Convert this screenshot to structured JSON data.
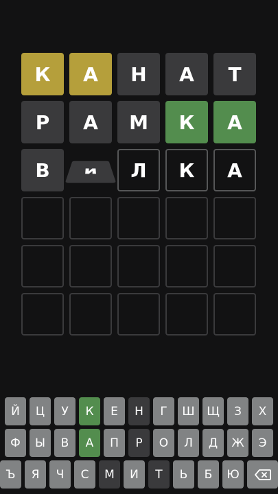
{
  "board": {
    "rows": [
      [
        {
          "letter": "К",
          "state": "present"
        },
        {
          "letter": "А",
          "state": "present"
        },
        {
          "letter": "Н",
          "state": "absent"
        },
        {
          "letter": "А",
          "state": "absent"
        },
        {
          "letter": "Т",
          "state": "absent"
        }
      ],
      [
        {
          "letter": "Р",
          "state": "absent"
        },
        {
          "letter": "А",
          "state": "absent"
        },
        {
          "letter": "М",
          "state": "absent"
        },
        {
          "letter": "К",
          "state": "correct"
        },
        {
          "letter": "А",
          "state": "correct"
        }
      ],
      [
        {
          "letter": "В",
          "state": "absent"
        },
        {
          "letter": "и",
          "state": "flipping"
        },
        {
          "letter": "Л",
          "state": "typed"
        },
        {
          "letter": "К",
          "state": "typed"
        },
        {
          "letter": "А",
          "state": "typed"
        }
      ],
      [
        {
          "letter": "",
          "state": "empty"
        },
        {
          "letter": "",
          "state": "empty"
        },
        {
          "letter": "",
          "state": "empty"
        },
        {
          "letter": "",
          "state": "empty"
        },
        {
          "letter": "",
          "state": "empty"
        }
      ],
      [
        {
          "letter": "",
          "state": "empty"
        },
        {
          "letter": "",
          "state": "empty"
        },
        {
          "letter": "",
          "state": "empty"
        },
        {
          "letter": "",
          "state": "empty"
        },
        {
          "letter": "",
          "state": "empty"
        }
      ],
      [
        {
          "letter": "",
          "state": "empty"
        },
        {
          "letter": "",
          "state": "empty"
        },
        {
          "letter": "",
          "state": "empty"
        },
        {
          "letter": "",
          "state": "empty"
        },
        {
          "letter": "",
          "state": "empty"
        }
      ]
    ]
  },
  "keyboard": {
    "rows": [
      [
        {
          "label": "Й",
          "state": "unused"
        },
        {
          "label": "Ц",
          "state": "unused"
        },
        {
          "label": "У",
          "state": "unused"
        },
        {
          "label": "К",
          "state": "correct"
        },
        {
          "label": "Е",
          "state": "unused"
        },
        {
          "label": "Н",
          "state": "absent"
        },
        {
          "label": "Г",
          "state": "unused"
        },
        {
          "label": "Ш",
          "state": "unused"
        },
        {
          "label": "Щ",
          "state": "unused"
        },
        {
          "label": "З",
          "state": "unused"
        },
        {
          "label": "Х",
          "state": "unused"
        }
      ],
      [
        {
          "label": "Ф",
          "state": "unused"
        },
        {
          "label": "Ы",
          "state": "unused"
        },
        {
          "label": "В",
          "state": "unused"
        },
        {
          "label": "А",
          "state": "correct"
        },
        {
          "label": "П",
          "state": "unused"
        },
        {
          "label": "Р",
          "state": "absent"
        },
        {
          "label": "О",
          "state": "unused"
        },
        {
          "label": "Л",
          "state": "unused"
        },
        {
          "label": "Д",
          "state": "unused"
        },
        {
          "label": "Ж",
          "state": "unused"
        },
        {
          "label": "Э",
          "state": "unused"
        }
      ],
      [
        {
          "label": "Ъ",
          "state": "unused"
        },
        {
          "label": "Я",
          "state": "unused"
        },
        {
          "label": "Ч",
          "state": "unused"
        },
        {
          "label": "С",
          "state": "unused"
        },
        {
          "label": "М",
          "state": "absent"
        },
        {
          "label": "И",
          "state": "unused"
        },
        {
          "label": "Т",
          "state": "absent"
        },
        {
          "label": "Ь",
          "state": "unused"
        },
        {
          "label": "Б",
          "state": "unused"
        },
        {
          "label": "Ю",
          "state": "unused"
        },
        {
          "label": "",
          "state": "unused",
          "icon": "backspace-icon"
        }
      ]
    ]
  },
  "colors": {
    "background": "#121213",
    "absent": "#3a3a3c",
    "present": "#b59f3b",
    "correct": "#538d4e",
    "key_default": "#818384",
    "empty_border": "#3a3a3c",
    "typed_border": "#565758"
  }
}
